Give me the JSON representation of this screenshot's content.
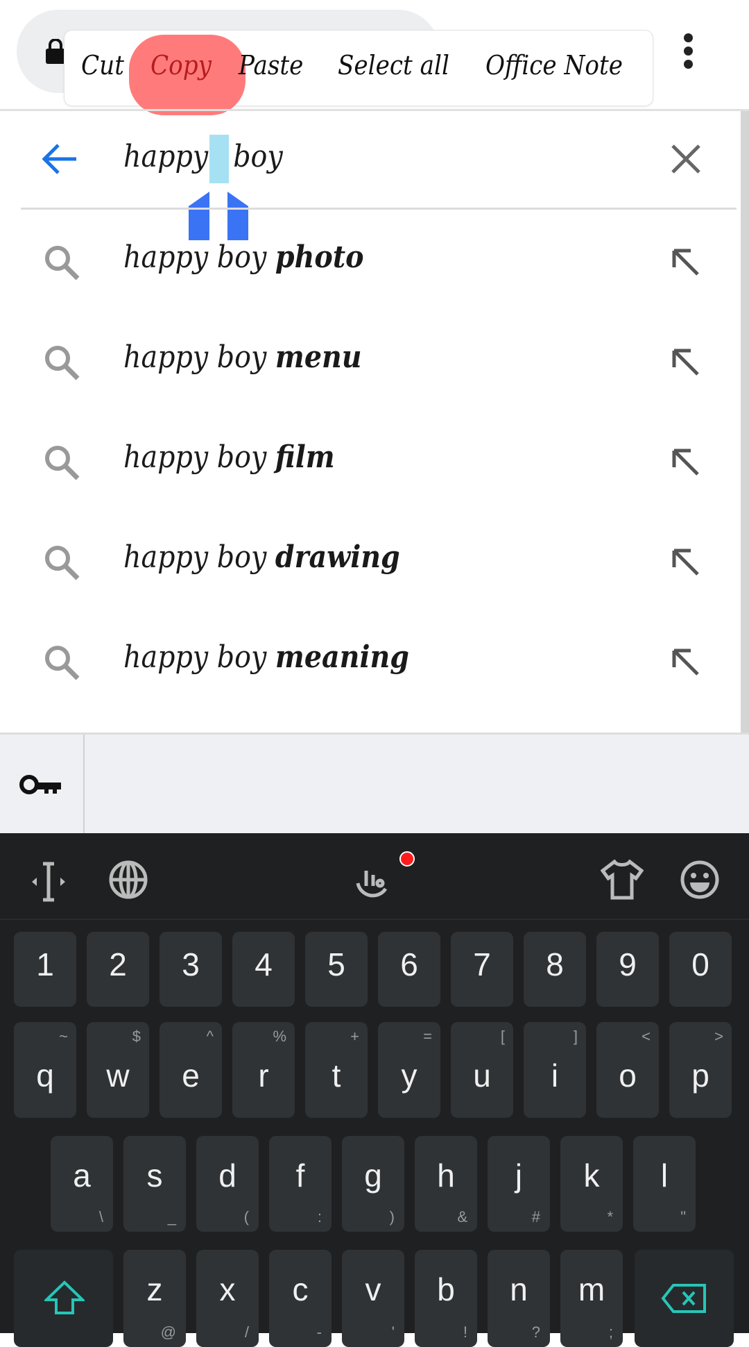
{
  "context_menu": {
    "items": [
      "Cut",
      "Copy",
      "Paste",
      "Select all",
      "Office Note"
    ],
    "highlighted": "Copy",
    "highlight_color": "#ff7b7b"
  },
  "search": {
    "query_part1": "happy",
    "query_part2": "boy",
    "accent": "#1a73e8"
  },
  "suggestions": [
    {
      "prefix": "happy boy ",
      "bold": "photo"
    },
    {
      "prefix": "happy boy ",
      "bold": "menu"
    },
    {
      "prefix": "happy boy ",
      "bold": "film"
    },
    {
      "prefix": "happy boy ",
      "bold": "drawing"
    },
    {
      "prefix": "happy boy ",
      "bold": "meaning"
    }
  ],
  "keyboard": {
    "toolbar_icons": [
      "cursor-icon",
      "globe-icon",
      "touchpal-icon",
      "theme-shirt-icon",
      "emoji-icon"
    ],
    "number_row": [
      "1",
      "2",
      "3",
      "4",
      "5",
      "6",
      "7",
      "8",
      "9",
      "0"
    ],
    "row1": [
      [
        "q",
        "~"
      ],
      [
        "w",
        "$"
      ],
      [
        "e",
        "^"
      ],
      [
        "r",
        "%"
      ],
      [
        "t",
        "+"
      ],
      [
        "y",
        "="
      ],
      [
        "u",
        "["
      ],
      [
        "i",
        "]"
      ],
      [
        "o",
        "<"
      ],
      [
        "p",
        ">"
      ]
    ],
    "row2": [
      [
        "a",
        "\\"
      ],
      [
        "s",
        "_"
      ],
      [
        "d",
        "("
      ],
      [
        "f",
        ":"
      ],
      [
        "g",
        ")"
      ],
      [
        "h",
        "&"
      ],
      [
        "j",
        "#"
      ],
      [
        "k",
        "*"
      ],
      [
        "l",
        "\""
      ]
    ],
    "row3": [
      [
        "z",
        "@"
      ],
      [
        "x",
        "/"
      ],
      [
        "c",
        "-"
      ],
      [
        "v",
        "'"
      ],
      [
        "b",
        "!"
      ],
      [
        "n",
        "?"
      ],
      [
        "m",
        ";"
      ]
    ],
    "accent": "#26c6b8"
  }
}
